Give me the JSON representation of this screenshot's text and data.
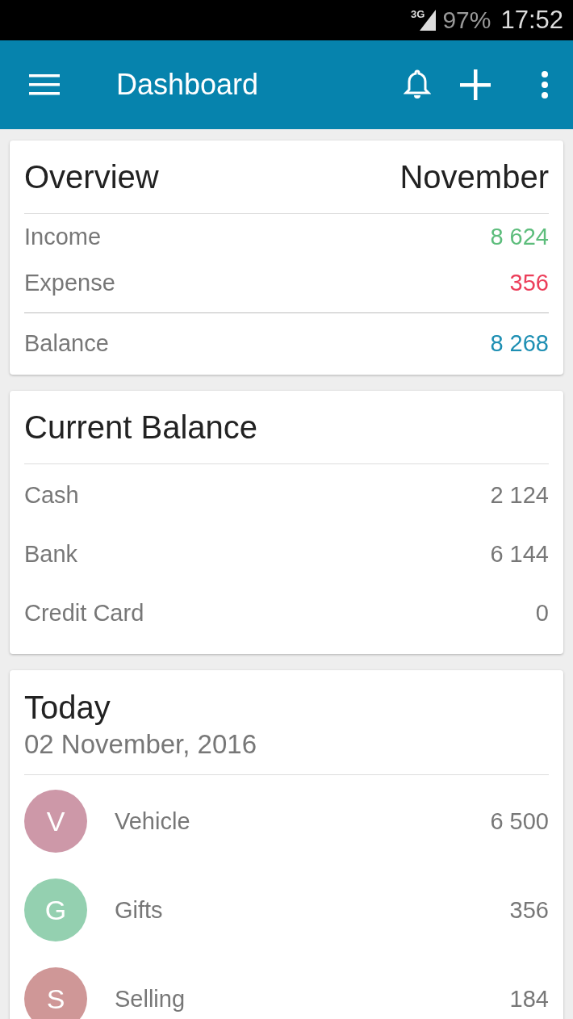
{
  "status_bar": {
    "network": "3G",
    "battery": "97%",
    "time": "17:52"
  },
  "app_bar": {
    "title": "Dashboard"
  },
  "overview": {
    "title": "Overview",
    "month": "November",
    "rows": [
      {
        "label": "Income",
        "value": "8 624",
        "kind": "income"
      },
      {
        "label": "Expense",
        "value": "356",
        "kind": "expense"
      },
      {
        "label": "Balance",
        "value": "8 268",
        "kind": "balance"
      }
    ]
  },
  "current_balance": {
    "title": "Current Balance",
    "accounts": [
      {
        "label": "Cash",
        "value": "2 124"
      },
      {
        "label": "Bank",
        "value": "6 144"
      },
      {
        "label": "Credit Card",
        "value": "0"
      }
    ]
  },
  "today": {
    "title": "Today",
    "date": "02 November, 2016",
    "transactions": [
      {
        "initial": "V",
        "category": "Vehicle",
        "amount": "6 500",
        "color": "#cd98a8"
      },
      {
        "initial": "G",
        "category": "Gifts",
        "amount": "356",
        "color": "#94d0b0"
      },
      {
        "initial": "S",
        "category": "Selling",
        "amount": "184",
        "color": "#cf9797"
      }
    ]
  }
}
